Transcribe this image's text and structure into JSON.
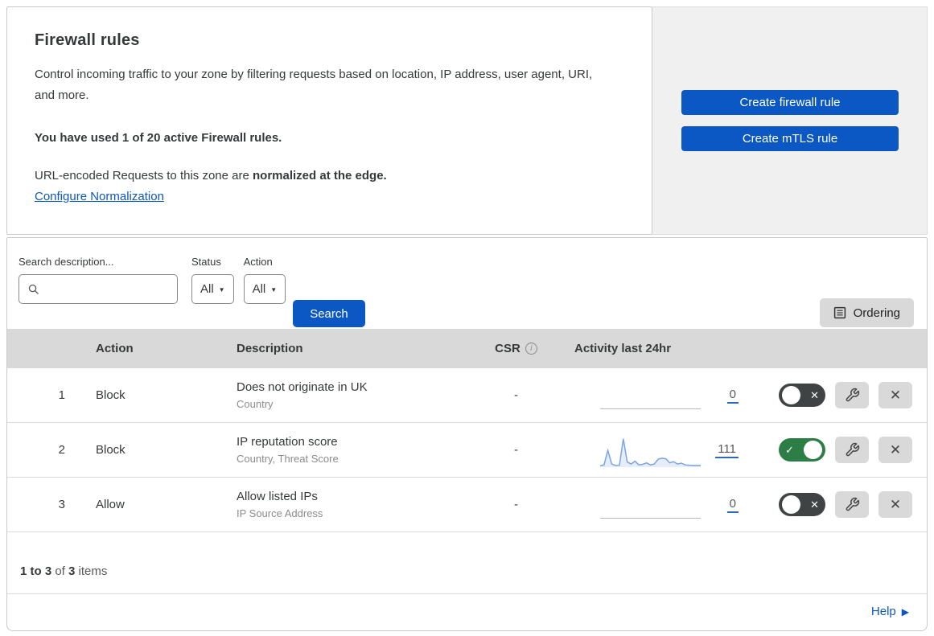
{
  "header": {
    "title": "Firewall rules",
    "description": "Control incoming traffic to your zone by filtering requests based on location, IP address, user agent, URI, and more.",
    "usage": "You have used 1 of 20 active Firewall rules.",
    "normalization_prefix": "URL-encoded Requests to this zone are ",
    "normalization_bold": "normalized at the edge.",
    "normalization_link": "Configure Normalization"
  },
  "actions_panel": {
    "create_firewall_label": "Create firewall rule",
    "create_mtls_label": "Create mTLS rule"
  },
  "filters": {
    "search_label": "Search description...",
    "status_label": "Status",
    "status_value": "All",
    "action_label": "Action",
    "action_value": "All",
    "search_button": "Search",
    "ordering_button": "Ordering"
  },
  "table": {
    "columns": {
      "action": "Action",
      "description": "Description",
      "csr": "CSR",
      "activity": "Activity last 24hr"
    },
    "rows": [
      {
        "index": "1",
        "action": "Block",
        "description": "Does not originate in UK",
        "fields": "Country",
        "csr": "-",
        "activity_count": "0",
        "enabled": false
      },
      {
        "index": "2",
        "action": "Block",
        "description": "IP reputation score",
        "fields": "Country, Threat Score",
        "csr": "-",
        "activity_count": "111",
        "enabled": true,
        "sparkline": [
          2,
          5,
          55,
          8,
          3,
          4,
          95,
          15,
          8,
          18,
          5,
          7,
          12,
          5,
          8,
          25,
          28,
          26,
          12,
          16,
          8,
          11,
          5,
          4,
          3,
          3,
          3
        ]
      },
      {
        "index": "3",
        "action": "Allow",
        "description": "Allow listed IPs",
        "fields": "IP Source Address",
        "csr": "-",
        "activity_count": "0",
        "enabled": false
      }
    ]
  },
  "footer": {
    "range_bold": "1 to 3",
    "of_text": " of ",
    "total_bold": "3",
    "items_text": " items",
    "help_label": "Help"
  },
  "colors": {
    "accent_blue": "#0b57c4",
    "toggle_on_green": "#2d7d46",
    "toggle_off_dark": "#404343",
    "sparkline_blue": "#7ba3e6",
    "panel_gray": "#f0f0f0",
    "header_band_gray": "#d9d9d9"
  }
}
